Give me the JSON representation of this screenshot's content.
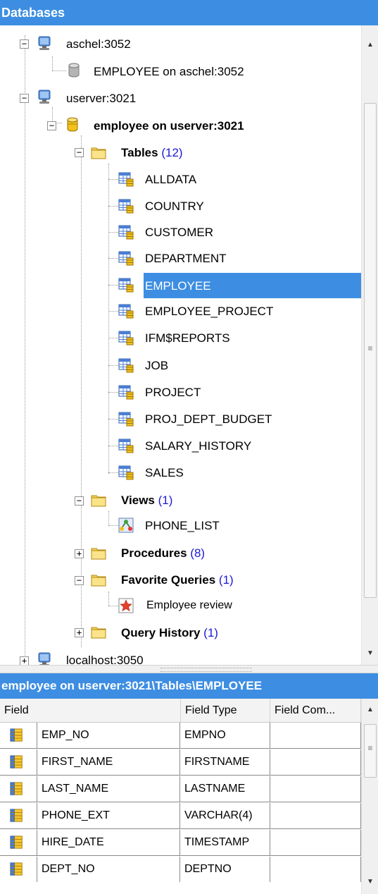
{
  "panel_title": "Databases",
  "tree": {
    "servers": [
      {
        "label": "aschel:3052",
        "databases": [
          {
            "label": "EMPLOYEE on aschel:3052"
          }
        ]
      },
      {
        "label": "userver:3021"
      },
      {
        "label": "localhost:3050"
      }
    ],
    "active_db": "employee on userver:3021",
    "tables_folder": {
      "label": "Tables",
      "count": "(12)"
    },
    "tables": [
      "ALLDATA",
      "COUNTRY",
      "CUSTOMER",
      "DEPARTMENT",
      "EMPLOYEE",
      "EMPLOYEE_PROJECT",
      "IFM$REPORTS",
      "JOB",
      "PROJECT",
      "PROJ_DEPT_BUDGET",
      "SALARY_HISTORY",
      "SALES"
    ],
    "selected_table": "EMPLOYEE",
    "views_folder": {
      "label": "Views",
      "count": "(1)"
    },
    "views": [
      "PHONE_LIST"
    ],
    "procedures_folder": {
      "label": "Procedures",
      "count": "(8)"
    },
    "favorites_folder": {
      "label": "Favorite Queries",
      "count": "(1)"
    },
    "favorites": [
      "Employee review"
    ],
    "history_folder": {
      "label": "Query History",
      "count": "(1)"
    }
  },
  "path_bar": "employee on userver:3021\\Tables\\EMPLOYEE",
  "grid": {
    "columns": [
      "Field",
      "Field Type",
      "Field Com..."
    ],
    "rows": [
      {
        "field": "EMP_NO",
        "type": "EMPNO",
        "comment": ""
      },
      {
        "field": "FIRST_NAME",
        "type": "FIRSTNAME",
        "comment": ""
      },
      {
        "field": "LAST_NAME",
        "type": "LASTNAME",
        "comment": ""
      },
      {
        "field": "PHONE_EXT",
        "type": "VARCHAR(4)",
        "comment": ""
      },
      {
        "field": "HIRE_DATE",
        "type": "TIMESTAMP",
        "comment": ""
      },
      {
        "field": "DEPT_NO",
        "type": "DEPTNO",
        "comment": ""
      }
    ]
  },
  "colors": {
    "accent": "#3d8ee2",
    "count_text": "#1a1ad6",
    "folder": "#f7d45c"
  }
}
